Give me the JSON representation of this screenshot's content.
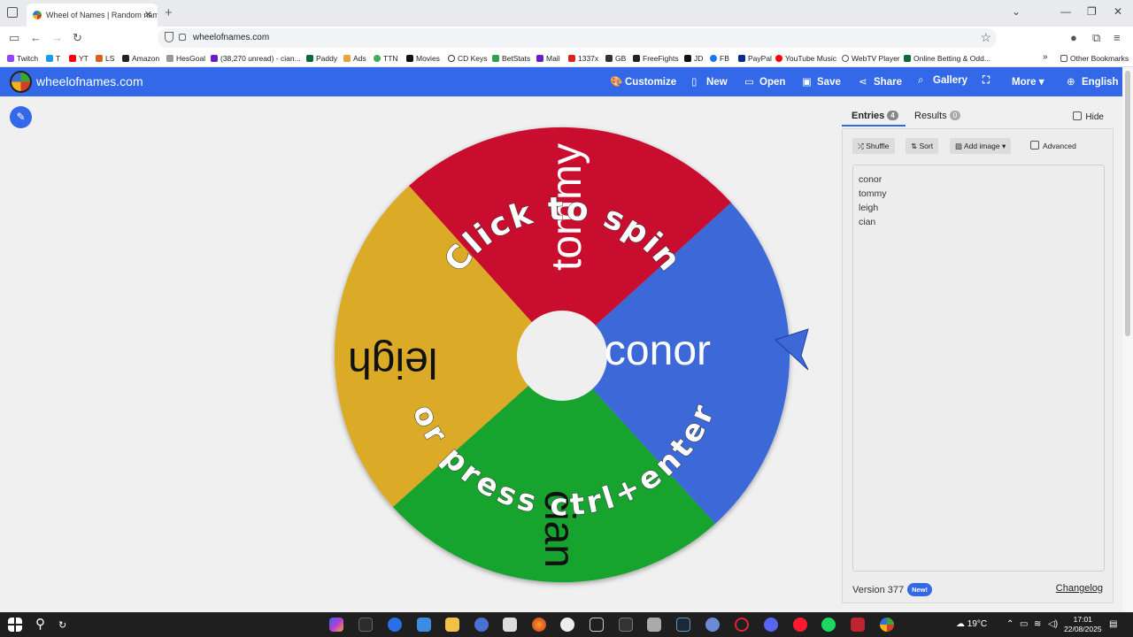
{
  "browser": {
    "tab_title": "Wheel of Names | Random nam",
    "url": "wheelofnames.com",
    "bookmarks": [
      "Twitch",
      "T",
      "YT",
      "LS",
      "Amazon",
      "HesGoal",
      "(38,270 unread) - cian...",
      "Paddy",
      "Ads",
      "TTN",
      "Movies",
      "CD Keys",
      "BetStats",
      "Mail",
      "1337x",
      "GB",
      "FreeFights",
      "JD",
      "FB",
      "PayPal",
      "YouTube Music",
      "WebTV Player",
      "Online Betting & Odd..."
    ],
    "other_bookmarks": "Other Bookmarks"
  },
  "app": {
    "site_title": "wheelofnames.com",
    "nav": {
      "customize": "Customize",
      "new": "New",
      "open": "Open",
      "save": "Save",
      "share": "Share",
      "gallery": "Gallery",
      "more": "More",
      "language": "English"
    }
  },
  "wheel": {
    "top_text": "Click to spin",
    "bottom_text": "or press ctrl+enter",
    "segments": [
      {
        "name": "conor",
        "color": "#3d69d8"
      },
      {
        "name": "tommy",
        "color": "#c9102f"
      },
      {
        "name": "leigh",
        "color": "#dbaa26"
      },
      {
        "name": "cian",
        "color": "#17a32e"
      }
    ]
  },
  "panel": {
    "entries_tab": "Entries",
    "entries_count": "4",
    "results_tab": "Results",
    "results_count": "0",
    "hide_label": "Hide",
    "shuffle_label": "Shuffle",
    "sort_label": "Sort",
    "add_image_label": "Add image",
    "advanced_label": "Advanced",
    "entries": [
      "conor",
      "tommy",
      "leigh",
      "cian"
    ],
    "version": "Version 377",
    "new_badge": "New!",
    "changelog": "Changelog"
  },
  "taskbar": {
    "temperature": "19°C",
    "time": "17:01",
    "date": "22/08/2025"
  }
}
